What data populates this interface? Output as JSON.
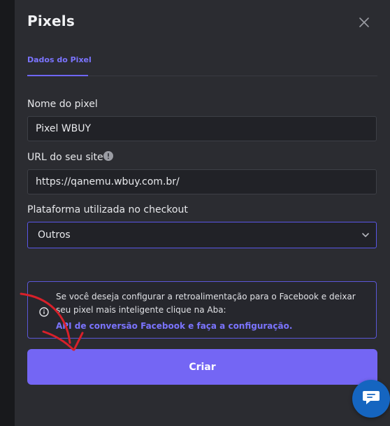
{
  "modal": {
    "title": "Pixels",
    "close_icon": "close-icon"
  },
  "tabs": [
    {
      "label": "Dados do Pixel",
      "active": true
    }
  ],
  "form": {
    "pixel_name": {
      "label": "Nome do pixel",
      "value": "Pixel WBUY"
    },
    "site_url": {
      "label": "URL do seu site",
      "value": "https://qanemu.wbuy.com.br/",
      "info_icon": "info-circle-icon"
    },
    "checkout_platform": {
      "label": "Plataforma utilizada no checkout",
      "selected": "Outros",
      "chevron_icon": "chevron-down-icon"
    }
  },
  "notice": {
    "icon": "info-icon",
    "text": "Se você deseja configurar a retroalimentação para o Facebook e deixar seu pixel mais inteligente clique na Aba:",
    "link": "API de conversão Facebook e faça a configuração."
  },
  "actions": {
    "create_label": "Criar"
  },
  "chat": {
    "icon": "chat-bubble-icon"
  },
  "colors": {
    "accent": "#7466f4",
    "panel": "#2b2c31",
    "annotation_red": "#d8202a",
    "chat": "#1565c0"
  }
}
